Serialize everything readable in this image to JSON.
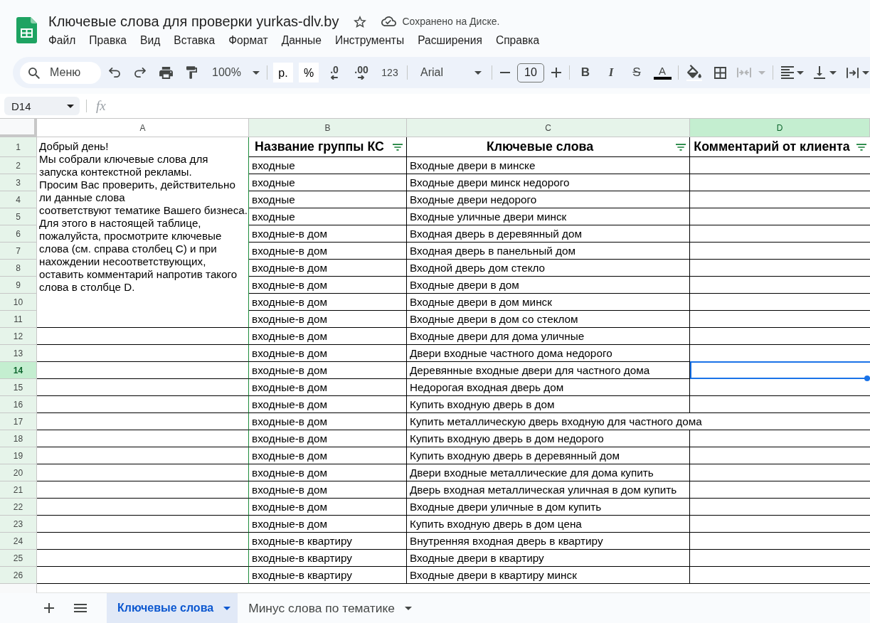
{
  "document": {
    "title": "Ключевые слова для проверки yurkas-dlv.by",
    "starred": false,
    "save_status": "Сохранено на Диске."
  },
  "menu": [
    "Файл",
    "Правка",
    "Вид",
    "Вставка",
    "Формат",
    "Данные",
    "Инструменты",
    "Расширения",
    "Справка"
  ],
  "toolbar": {
    "search": {
      "placeholder": "Меню"
    },
    "zoom": "100%",
    "currency": "р.",
    "percent": "%",
    "decrease_decimals": ".0",
    "increase_decimals": ".00",
    "number_format": "123",
    "font": "Arial",
    "font_size": "10",
    "bold": "B",
    "italic": "I",
    "strikethrough": "S",
    "text_color": "A",
    "merge": {
      "disabled": true
    }
  },
  "formula_bar": {
    "cell_ref": "D14",
    "fx": "fx"
  },
  "sheet": {
    "columns": [
      {
        "letter": "A",
        "filtered": false,
        "selected": false
      },
      {
        "letter": "B",
        "filtered": true,
        "selected": false
      },
      {
        "letter": "C",
        "filtered": true,
        "selected": false
      },
      {
        "letter": "D",
        "filtered": true,
        "selected": true
      }
    ],
    "header_row": {
      "label": "1",
      "filtered": true
    },
    "intro_text": "Добрый день!\nМы собрали ключевые слова для запуска контекстной рекламы.\nПросим Вас проверить, действительно ли данные слова\nсоответствуют тематике Вашего бизнеса.\nДля этого в настоящей таблице, пожалуйста, просмотрите ключевые слова (см. справа столбец C) и при нахождении несоответствующих, оставить комментарий напротив такого слова в столбце D.",
    "titles": [
      {
        "text": "Название группы КС",
        "filter": true
      },
      {
        "text": "Ключевые слова",
        "filter": true
      },
      {
        "text": "Комментарий от клиента",
        "filter": true
      }
    ],
    "rows": [
      {
        "label": "2",
        "filtered": true,
        "group": "входные",
        "keyword": "Входные двери в минске",
        "selected": false
      },
      {
        "label": "3",
        "filtered": true,
        "group": "входные",
        "keyword": "Входные двери минск недорого",
        "selected": false
      },
      {
        "label": "4",
        "filtered": true,
        "group": "входные",
        "keyword": "Входные двери недорого",
        "selected": false
      },
      {
        "label": "5",
        "filtered": true,
        "group": "входные",
        "keyword": "Входные уличные двери минск",
        "selected": false
      },
      {
        "label": "6",
        "filtered": true,
        "group": "входные-в дом",
        "keyword": "Входная дверь в деревянный дом",
        "selected": false
      },
      {
        "label": "7",
        "filtered": true,
        "group": "входные-в дом",
        "keyword": "Входная дверь в панельный дом",
        "selected": false
      },
      {
        "label": "8",
        "filtered": true,
        "group": "входные-в дом",
        "keyword": "Входной дверь дом стекло",
        "selected": false
      },
      {
        "label": "9",
        "filtered": true,
        "group": "входные-в дом",
        "keyword": "Входные двери в дом",
        "selected": false
      },
      {
        "label": "10",
        "filtered": true,
        "group": "входные-в дом",
        "keyword": "Входные двери в дом минск",
        "selected": false
      },
      {
        "label": "11",
        "filtered": true,
        "group": "входные-в дом",
        "keyword": "Входные двери в дом со стеклом",
        "selected": false
      },
      {
        "label": "12",
        "filtered": true,
        "group": "входные-в дом",
        "keyword": "Входные двери для дома уличные",
        "selected": false
      },
      {
        "label": "13",
        "filtered": true,
        "group": "входные-в дом",
        "keyword": "Двери входные частного дома недорого",
        "selected": false
      },
      {
        "label": "14",
        "filtered": true,
        "group": "входные-в дом",
        "keyword": "Деревянные входные двери для частного дома",
        "selected": true
      },
      {
        "label": "15",
        "filtered": true,
        "group": "входные-в дом",
        "keyword": "Недорогая входная дверь дом",
        "selected": false
      },
      {
        "label": "16",
        "filtered": true,
        "group": "входные-в дом",
        "keyword": "Купить входную дверь в дом",
        "selected": false
      },
      {
        "label": "17",
        "filtered": true,
        "group": "входные-в дом",
        "keyword": "Купить металлическую дверь входную для частного дома",
        "selected": false
      },
      {
        "label": "18",
        "filtered": true,
        "group": "входные-в дом",
        "keyword": "Купить входную дверь в дом недорого",
        "selected": false
      },
      {
        "label": "19",
        "filtered": true,
        "group": "входные-в дом",
        "keyword": "Купить входную дверь в деревянный дом",
        "selected": false
      },
      {
        "label": "20",
        "filtered": true,
        "group": "входные-в дом",
        "keyword": "Двери входные металлические для дома купить",
        "selected": false
      },
      {
        "label": "21",
        "filtered": true,
        "group": "входные-в дом",
        "keyword": "Дверь входная металлическая уличная в дом купить",
        "selected": false
      },
      {
        "label": "22",
        "filtered": true,
        "group": "входные-в дом",
        "keyword": "Входные двери уличные в дом купить",
        "selected": false
      },
      {
        "label": "23",
        "filtered": true,
        "group": "входные-в дом",
        "keyword": "Купить входную дверь в дом цена",
        "selected": false
      },
      {
        "label": "24",
        "filtered": true,
        "group": "входные-в квартиру",
        "keyword": "Внутренняя входная дверь в квартиру",
        "selected": false
      },
      {
        "label": "25",
        "filtered": true,
        "group": "входные-в квартиру",
        "keyword": "Входные двери в квартиру",
        "selected": false
      },
      {
        "label": "26",
        "filtered": true,
        "group": "входные-в квартиру",
        "keyword": "Входные двери в квартиру минск",
        "selected": false
      }
    ]
  },
  "sheet_tabs": [
    {
      "label": "Ключевые слова",
      "selected": true
    },
    {
      "label": "Минус слова по тематике",
      "selected": false
    }
  ]
}
